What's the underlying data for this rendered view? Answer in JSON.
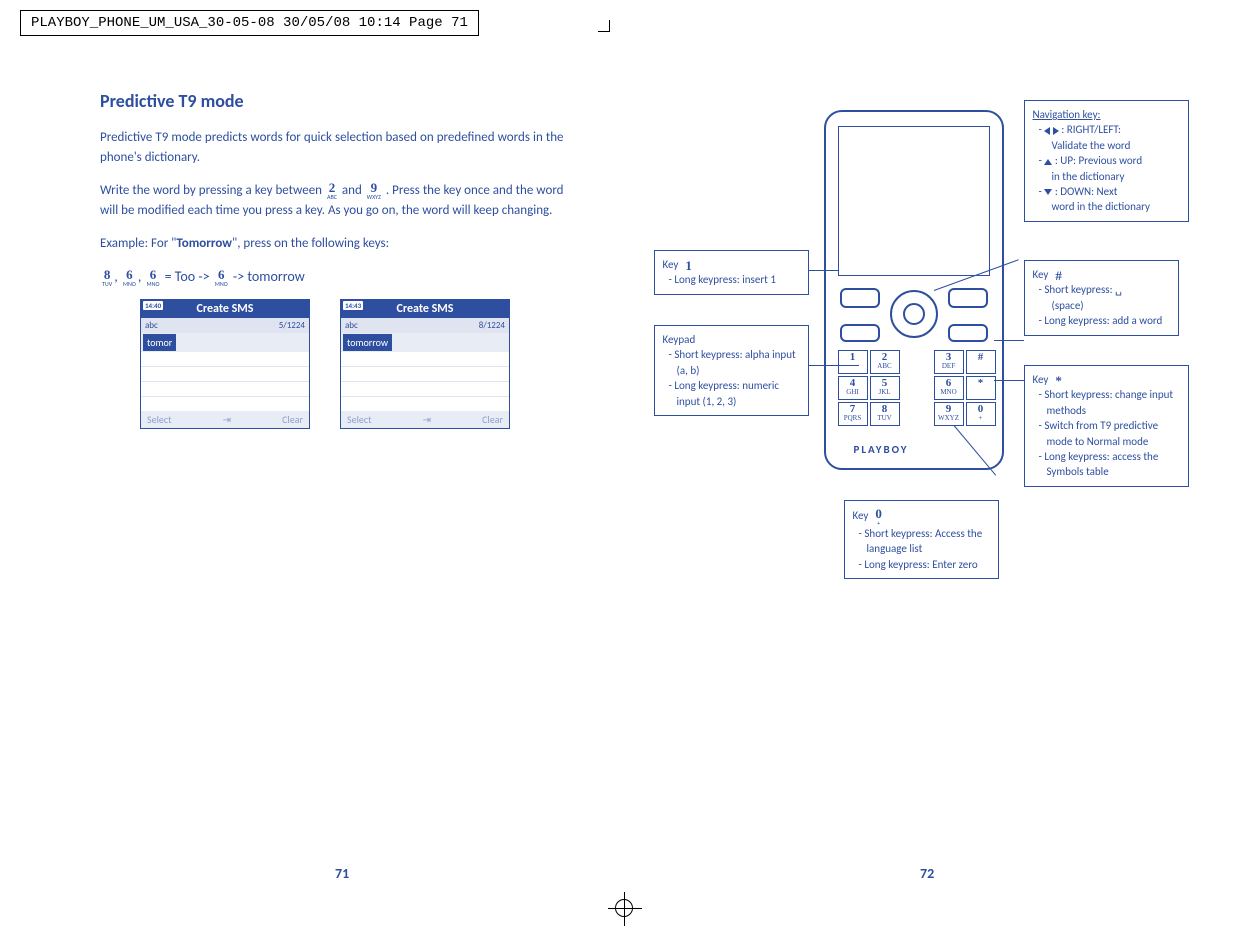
{
  "header_bar": "PLAYBOY_PHONE_UM_USA_30-05-08  30/05/08  10:14  Page 71",
  "section_title": "Predictive T9 mode",
  "para1": "Predictive T9 mode predicts words for quick selection based on predefined words in the phone's dictionary.",
  "para2_pre": "Write the word by pressing a key between ",
  "key2": {
    "digit": "2",
    "sub": "ABC"
  },
  "para2_mid": " and ",
  "key9": {
    "digit": "9",
    "sub": "WXYZ"
  },
  "para2_post": ".  Press the key once and the word will be modified each time you press a key.  As you go on, the word will keep changing.",
  "example_label_pre": "Example: For \"",
  "example_word": "Tomorrow",
  "example_label_post": "\", press on the following keys:",
  "seq": {
    "k8": {
      "digit": "8",
      "sub": "TUV"
    },
    "k6a": {
      "digit": "6",
      "sub": "MNO"
    },
    "k6b": {
      "digit": "6",
      "sub": "MNO"
    },
    "eq": " = Too -> ",
    "k6c": {
      "digit": "6",
      "sub": "MNO"
    },
    "tail": " -> tomorrow"
  },
  "screens": {
    "left": {
      "time": "14:40",
      "title": "Create SMS",
      "status_left": "abc",
      "status_right": "5/1224",
      "typed": "tomor",
      "soft_left": "Select",
      "soft_right": "Clear"
    },
    "right": {
      "time": "14:43",
      "title": "Create SMS",
      "status_left": "abc",
      "status_right": "8/1224",
      "typed": "tomorrow",
      "soft_left": "Select",
      "soft_right": "Clear"
    }
  },
  "page_left": "71",
  "page_right": "72",
  "phone_brand": "PLAYBOY",
  "keypad": [
    {
      "d": "1",
      "s": ""
    },
    {
      "d": "2",
      "s": "ABC"
    },
    {
      "d": "",
      "s": ""
    },
    {
      "d": "3",
      "s": "DEF"
    },
    {
      "d": "#",
      "s": ""
    },
    {
      "d": "4",
      "s": "GHI"
    },
    {
      "d": "5",
      "s": "JKL"
    },
    {
      "d": "",
      "s": ""
    },
    {
      "d": "6",
      "s": "MNO"
    },
    {
      "d": "*",
      "s": ""
    },
    {
      "d": "7",
      "s": "PQRS"
    },
    {
      "d": "8",
      "s": "TUV"
    },
    {
      "d": "",
      "s": ""
    },
    {
      "d": "9",
      "s": "WXYZ"
    },
    {
      "d": "0",
      "s": "+"
    }
  ],
  "anno": {
    "nav": {
      "title": "Navigation key:",
      "l1a": ": RIGHT/LEFT:",
      "l1b": "Validate the word",
      "l2a": ": UP: Previous word",
      "l2b": "in the dictionary",
      "l3a": ": DOWN: Next",
      "l3b": "word in the dictionary"
    },
    "key1": {
      "title": "Key",
      "key_digit": "1",
      "l1": "Long keypress: insert 1"
    },
    "keypad": {
      "title": "Keypad",
      "l1": "Short keypress: alpha input (a, b)",
      "l2": "Long keypress: numeric input (1, 2, 3)"
    },
    "keyhash": {
      "title": "Key",
      "key_sym": "#",
      "l1": "Short keypress:",
      "l1b": "(space)",
      "l2": "Long keypress: add a word"
    },
    "keystar": {
      "title": "Key",
      "key_sym": "*",
      "l1": "Short keypress: change input methods",
      "l2": "Switch from T9 predictive mode to Normal mode",
      "l3": "Long keypress: access the Symbols table"
    },
    "key0": {
      "title": "Key",
      "key_digit": "0",
      "key_sub": "+",
      "l1": "Short keypress: Access the language list",
      "l2": "Long keypress: Enter zero"
    }
  }
}
